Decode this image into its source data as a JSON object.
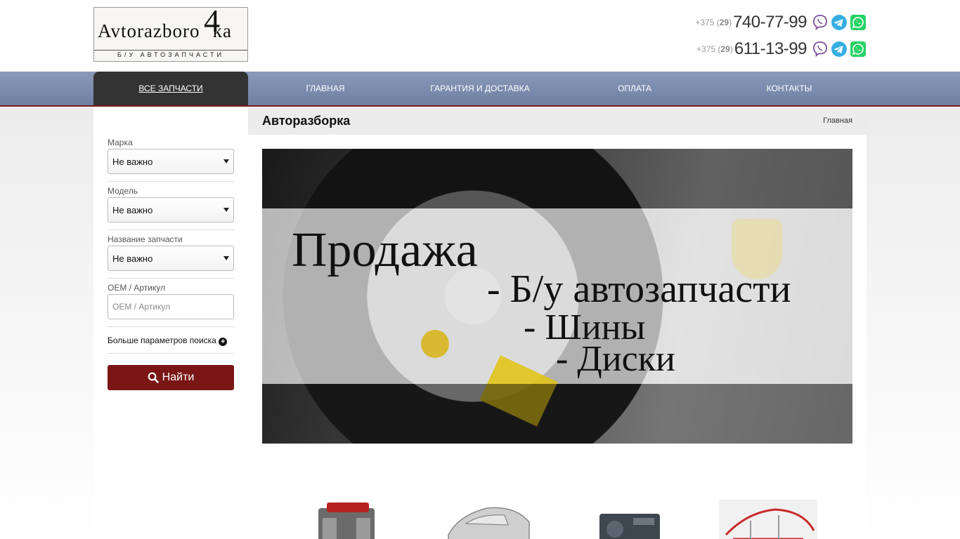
{
  "logo": {
    "text_main": "Avtorazboro",
    "text_big": "4",
    "text_end": "ka",
    "subtitle": "Б/У АВТОЗАПЧАСТИ"
  },
  "phones": [
    {
      "prefix": "+375 (",
      "code": "29",
      "suffix": ")",
      "number": "740-77-99"
    },
    {
      "prefix": "+375 (",
      "code": "29",
      "suffix": ")",
      "number": "611-13-99"
    }
  ],
  "icons": {
    "viber": "viber-icon",
    "telegram": "telegram-icon",
    "whatsapp": "whatsapp-icon",
    "search": "search-icon",
    "plus": "plus-circle-icon"
  },
  "colors": {
    "accent": "#7a1616",
    "nav": "#7b8cae",
    "nav_active": "#333333",
    "viber": "#7b519d",
    "telegram": "#37aee2",
    "whatsapp": "#25d366"
  },
  "nav": {
    "items": [
      {
        "label": "ВСЕ ЗАПЧАСТИ",
        "active": true
      },
      {
        "label": "ГЛАВНАЯ"
      },
      {
        "label": "ГАРАНТИЯ И ДОСТАВКА"
      },
      {
        "label": "ОПЛАТА"
      },
      {
        "label": "КОНТАКТЫ"
      }
    ]
  },
  "filters": {
    "brand": {
      "label": "Марка",
      "value": "Не важно"
    },
    "model": {
      "label": "Модель",
      "value": "Не важно"
    },
    "part": {
      "label": "Название запчасти",
      "value": "Не важно"
    },
    "oem": {
      "label": "OEM / Артикул",
      "placeholder": "OEM / Артикул"
    },
    "more_label": "Больше параметров поиска",
    "search_label": "Найти"
  },
  "main": {
    "title": "Авторазборка",
    "breadcrumb": "Главная"
  },
  "banner": {
    "line1": "Продажа",
    "line2": "- Б/у автозапчасти",
    "line3": "- Шины",
    "line4": "- Диски"
  }
}
